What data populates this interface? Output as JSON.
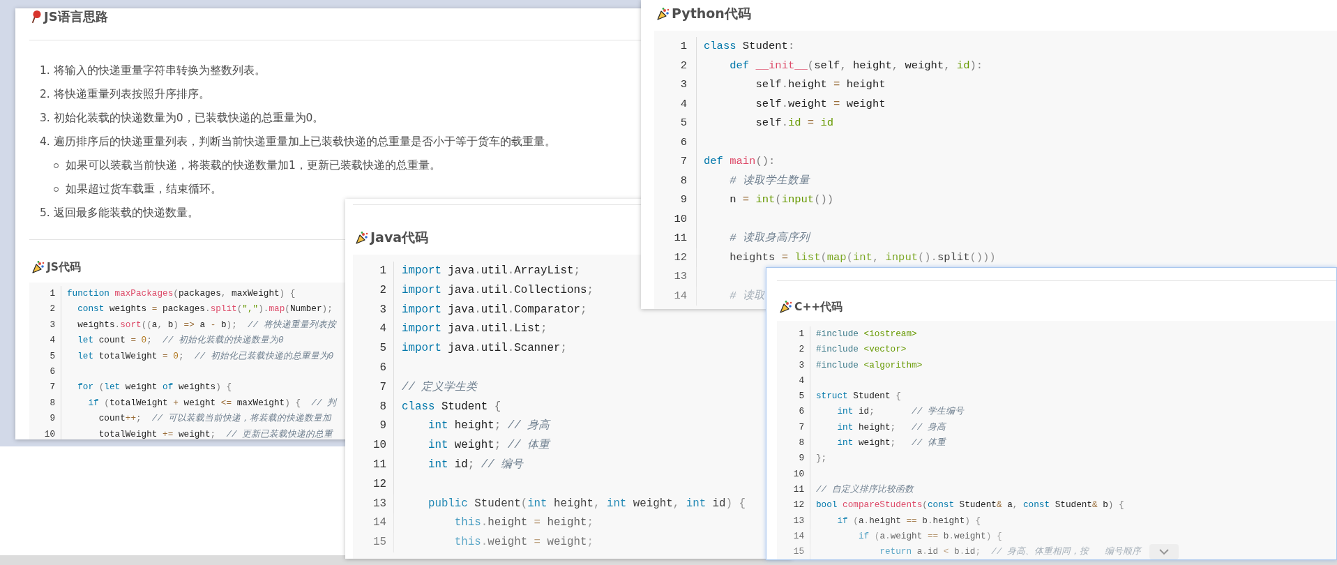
{
  "windows": [
    {
      "blocks": [
        {
          "kind": "idea_heading",
          "text": "JS语言思路"
        },
        {
          "kind": "rule"
        },
        {
          "kind": "list",
          "items": [
            {
              "num": "1.",
              "text": "将输入的快递重量字符串转换为整数列表。"
            },
            {
              "num": "2.",
              "text": "将快递重量列表按照升序排序。"
            },
            {
              "num": "3.",
              "text": "初始化装载的快递数量为0，已装载快递的总重量为0。"
            },
            {
              "num": "4.",
              "text": "遍历排序后的快递重量列表，判断当前快递重量加上已装载快递的总重量是否小于等于货车的载重量。",
              "children": [
                {
                  "text": "如果可以装载当前快递，将装载的快递数量加1，更新已装载快递的总重量。"
                },
                {
                  "text": "如果超过货车载重，结束循环。"
                }
              ]
            },
            {
              "num": "5.",
              "text": "返回最多能装载的快递数量。"
            }
          ]
        },
        {
          "kind": "rule"
        },
        {
          "kind": "code_heading",
          "text": "JS代码"
        },
        {
          "kind": "code",
          "collapsed": false,
          "lines": [
            {
              "n": "1",
              "t": [
                {
                  "kind": "kw",
                  "text": "function "
                },
                {
                  "kind": "fn",
                  "text": "maxPackages"
                },
                {
                  "kind": "pu",
                  "text": "("
                },
                {
                  "kind": "pl",
                  "text": "packages"
                },
                {
                  "kind": "pu",
                  "text": ","
                },
                {
                  "kind": "pl",
                  "text": " maxWeight"
                },
                {
                  "kind": "pu",
                  "text": ") {"
                }
              ]
            },
            {
              "n": "2",
              "t": [
                {
                  "kind": "kw",
                  "text": "  const "
                },
                {
                  "kind": "pl",
                  "text": "weights "
                },
                {
                  "kind": "op",
                  "text": "= "
                },
                {
                  "kind": "pl",
                  "text": "packages"
                },
                {
                  "kind": "pu",
                  "text": "."
                },
                {
                  "kind": "fn",
                  "text": "split"
                },
                {
                  "kind": "pu",
                  "text": "("
                },
                {
                  "kind": "st",
                  "text": "\",\""
                },
                {
                  "kind": "pu",
                  "text": ")."
                },
                {
                  "kind": "fn",
                  "text": "map"
                },
                {
                  "kind": "pu",
                  "text": "("
                },
                {
                  "kind": "pl",
                  "text": "Number"
                },
                {
                  "kind": "pu",
                  "text": ");"
                }
              ]
            },
            {
              "n": "3",
              "t": [
                {
                  "kind": "pl",
                  "text": "  weights"
                },
                {
                  "kind": "pu",
                  "text": "."
                },
                {
                  "kind": "fn",
                  "text": "sort"
                },
                {
                  "kind": "pu",
                  "text": "(("
                },
                {
                  "kind": "pl",
                  "text": "a"
                },
                {
                  "kind": "pu",
                  "text": ", "
                },
                {
                  "kind": "pl",
                  "text": "b"
                },
                {
                  "kind": "pu",
                  "text": ") "
                },
                {
                  "kind": "op",
                  "text": "=> "
                },
                {
                  "kind": "pl",
                  "text": "a "
                },
                {
                  "kind": "op",
                  "text": "- "
                },
                {
                  "kind": "pl",
                  "text": "b"
                },
                {
                  "kind": "pu",
                  "text": ");  "
                },
                {
                  "kind": "cm",
                  "text": "// 将快递重量列表按"
                }
              ]
            },
            {
              "n": "4",
              "t": [
                {
                  "kind": "kw",
                  "text": "  let "
                },
                {
                  "kind": "pl",
                  "text": "count "
                },
                {
                  "kind": "op",
                  "text": "= "
                },
                {
                  "kind": "nu",
                  "text": "0"
                },
                {
                  "kind": "pu",
                  "text": ";  "
                },
                {
                  "kind": "cm",
                  "text": "// 初始化装载的快递数量为0"
                }
              ]
            },
            {
              "n": "5",
              "t": [
                {
                  "kind": "kw",
                  "text": "  let "
                },
                {
                  "kind": "pl",
                  "text": "totalWeight "
                },
                {
                  "kind": "op",
                  "text": "= "
                },
                {
                  "kind": "nu",
                  "text": "0"
                },
                {
                  "kind": "pu",
                  "text": ";  "
                },
                {
                  "kind": "cm",
                  "text": "// 初始化已装载快递的总重量为0"
                }
              ]
            },
            {
              "n": "6"
            },
            {
              "n": "7",
              "t": [
                {
                  "kind": "kw",
                  "text": "  for "
                },
                {
                  "kind": "pu",
                  "text": "("
                },
                {
                  "kind": "kw",
                  "text": "let "
                },
                {
                  "kind": "pl",
                  "text": "weight "
                },
                {
                  "kind": "kw",
                  "text": "of "
                },
                {
                  "kind": "pl",
                  "text": "weights"
                },
                {
                  "kind": "pu",
                  "text": ") {"
                }
              ]
            },
            {
              "n": "8",
              "t": [
                {
                  "kind": "kw",
                  "text": "    if "
                },
                {
                  "kind": "pu",
                  "text": "("
                },
                {
                  "kind": "pl",
                  "text": "totalWeight "
                },
                {
                  "kind": "op",
                  "text": "+ "
                },
                {
                  "kind": "pl",
                  "text": "weight "
                },
                {
                  "kind": "op",
                  "text": "<= "
                },
                {
                  "kind": "pl",
                  "text": "maxWeight"
                },
                {
                  "kind": "pu",
                  "text": ") {  "
                },
                {
                  "kind": "cm",
                  "text": "// 判"
                }
              ]
            },
            {
              "n": "9",
              "t": [
                {
                  "kind": "pl",
                  "text": "      count"
                },
                {
                  "kind": "op",
                  "text": "++"
                },
                {
                  "kind": "pu",
                  "text": ";  "
                },
                {
                  "kind": "cm",
                  "text": "// 可以装载当前快递，将装载的快递数量加"
                }
              ]
            },
            {
              "n": "10",
              "t": [
                {
                  "kind": "pl",
                  "text": "      totalWeight "
                },
                {
                  "kind": "op",
                  "text": "+= "
                },
                {
                  "kind": "pl",
                  "text": "weight"
                },
                {
                  "kind": "pu",
                  "text": ";  "
                },
                {
                  "kind": "cm",
                  "text": "// 更新已装载快递的总重"
                }
              ]
            }
          ]
        }
      ]
    },
    {
      "blocks": [
        {
          "kind": "rule"
        },
        {
          "kind": "code_heading",
          "text": "Java代码"
        },
        {
          "kind": "code",
          "collapsed": true,
          "lines": [
            {
              "n": "1",
              "t": [
                {
                  "kind": "kw",
                  "text": "import "
                },
                {
                  "kind": "pl",
                  "text": "java"
                },
                {
                  "kind": "pu",
                  "text": "."
                },
                {
                  "kind": "pl",
                  "text": "util"
                },
                {
                  "kind": "pu",
                  "text": "."
                },
                {
                  "kind": "pl",
                  "text": "ArrayList"
                },
                {
                  "kind": "pu",
                  "text": ";"
                }
              ]
            },
            {
              "n": "2",
              "t": [
                {
                  "kind": "kw",
                  "text": "import "
                },
                {
                  "kind": "pl",
                  "text": "java"
                },
                {
                  "kind": "pu",
                  "text": "."
                },
                {
                  "kind": "pl",
                  "text": "util"
                },
                {
                  "kind": "pu",
                  "text": "."
                },
                {
                  "kind": "pl",
                  "text": "Collections"
                },
                {
                  "kind": "pu",
                  "text": ";"
                }
              ]
            },
            {
              "n": "3",
              "t": [
                {
                  "kind": "kw",
                  "text": "import "
                },
                {
                  "kind": "pl",
                  "text": "java"
                },
                {
                  "kind": "pu",
                  "text": "."
                },
                {
                  "kind": "pl",
                  "text": "util"
                },
                {
                  "kind": "pu",
                  "text": "."
                },
                {
                  "kind": "pl",
                  "text": "Comparator"
                },
                {
                  "kind": "pu",
                  "text": ";"
                }
              ]
            },
            {
              "n": "4",
              "t": [
                {
                  "kind": "kw",
                  "text": "import "
                },
                {
                  "kind": "pl",
                  "text": "java"
                },
                {
                  "kind": "pu",
                  "text": "."
                },
                {
                  "kind": "pl",
                  "text": "util"
                },
                {
                  "kind": "pu",
                  "text": "."
                },
                {
                  "kind": "pl",
                  "text": "List"
                },
                {
                  "kind": "pu",
                  "text": ";"
                }
              ]
            },
            {
              "n": "5",
              "t": [
                {
                  "kind": "kw",
                  "text": "import "
                },
                {
                  "kind": "pl",
                  "text": "java"
                },
                {
                  "kind": "pu",
                  "text": "."
                },
                {
                  "kind": "pl",
                  "text": "util"
                },
                {
                  "kind": "pu",
                  "text": "."
                },
                {
                  "kind": "pl",
                  "text": "Scanner"
                },
                {
                  "kind": "pu",
                  "text": ";"
                }
              ]
            },
            {
              "n": "6"
            },
            {
              "n": "7",
              "t": [
                {
                  "kind": "cm",
                  "text": "// 定义学生类"
                }
              ]
            },
            {
              "n": "8",
              "t": [
                {
                  "kind": "kw",
                  "text": "class "
                },
                {
                  "kind": "pl",
                  "text": "Student "
                },
                {
                  "kind": "pu",
                  "text": "{"
                }
              ]
            },
            {
              "n": "9",
              "t": [
                {
                  "kind": "kw",
                  "text": "    int "
                },
                {
                  "kind": "pl",
                  "text": "height"
                },
                {
                  "kind": "pu",
                  "text": "; "
                },
                {
                  "kind": "cm",
                  "text": "// 身高"
                }
              ]
            },
            {
              "n": "10",
              "t": [
                {
                  "kind": "kw",
                  "text": "    int "
                },
                {
                  "kind": "pl",
                  "text": "weight"
                },
                {
                  "kind": "pu",
                  "text": "; "
                },
                {
                  "kind": "cm",
                  "text": "// 体重"
                }
              ]
            },
            {
              "n": "11",
              "t": [
                {
                  "kind": "kw",
                  "text": "    int "
                },
                {
                  "kind": "pl",
                  "text": "id"
                },
                {
                  "kind": "pu",
                  "text": "; "
                },
                {
                  "kind": "cm",
                  "text": "// 编号"
                }
              ]
            },
            {
              "n": "12"
            },
            {
              "n": "13",
              "t": [
                {
                  "kind": "kw",
                  "text": "    public "
                },
                {
                  "kind": "pl",
                  "text": "Student"
                },
                {
                  "kind": "pu",
                  "text": "("
                },
                {
                  "kind": "kw",
                  "text": "int "
                },
                {
                  "kind": "pl",
                  "text": "height"
                },
                {
                  "kind": "pu",
                  "text": ", "
                },
                {
                  "kind": "kw",
                  "text": "int "
                },
                {
                  "kind": "pl",
                  "text": "weight"
                },
                {
                  "kind": "pu",
                  "text": ", "
                },
                {
                  "kind": "kw",
                  "text": "int "
                },
                {
                  "kind": "pl",
                  "text": "id"
                },
                {
                  "kind": "pu",
                  "text": ") {"
                }
              ]
            },
            {
              "n": "14",
              "t": [
                {
                  "kind": "kw",
                  "text": "        this"
                },
                {
                  "kind": "pu",
                  "text": "."
                },
                {
                  "kind": "pl",
                  "text": "height "
                },
                {
                  "kind": "op",
                  "text": "= "
                },
                {
                  "kind": "pl",
                  "text": "height"
                },
                {
                  "kind": "pu",
                  "text": ";"
                }
              ]
            },
            {
              "n": "15",
              "t": [
                {
                  "kind": "kw",
                  "text": "        this"
                },
                {
                  "kind": "pu",
                  "text": "."
                },
                {
                  "kind": "pl",
                  "text": "weight "
                },
                {
                  "kind": "op",
                  "text": "= "
                },
                {
                  "kind": "pl",
                  "text": "weight"
                },
                {
                  "kind": "pu",
                  "text": ";"
                }
              ]
            }
          ]
        }
      ]
    },
    {
      "blocks": [
        {
          "kind": "code_heading",
          "text": "Python代码"
        },
        {
          "kind": "code",
          "collapsed": true,
          "lines": [
            {
              "n": "1",
              "t": [
                {
                  "kind": "kw",
                  "text": "class "
                },
                {
                  "kind": "pl",
                  "text": "Student"
                },
                {
                  "kind": "pu",
                  "text": ":"
                }
              ]
            },
            {
              "n": "2",
              "t": [
                {
                  "kind": "kw",
                  "text": "    def "
                },
                {
                  "kind": "fn",
                  "text": "__init__"
                },
                {
                  "kind": "pu",
                  "text": "("
                },
                {
                  "kind": "pl",
                  "text": "self"
                },
                {
                  "kind": "pu",
                  "text": ", "
                },
                {
                  "kind": "pl",
                  "text": "height"
                },
                {
                  "kind": "pu",
                  "text": ", "
                },
                {
                  "kind": "pl",
                  "text": "weight"
                },
                {
                  "kind": "pu",
                  "text": ", "
                },
                {
                  "kind": "bi",
                  "text": "id"
                },
                {
                  "kind": "pu",
                  "text": "):"
                }
              ]
            },
            {
              "n": "3",
              "t": [
                {
                  "kind": "pl",
                  "text": "        self"
                },
                {
                  "kind": "pu",
                  "text": "."
                },
                {
                  "kind": "pl",
                  "text": "height "
                },
                {
                  "kind": "op",
                  "text": "= "
                },
                {
                  "kind": "pl",
                  "text": "height"
                }
              ]
            },
            {
              "n": "4",
              "t": [
                {
                  "kind": "pl",
                  "text": "        self"
                },
                {
                  "kind": "pu",
                  "text": "."
                },
                {
                  "kind": "pl",
                  "text": "weight "
                },
                {
                  "kind": "op",
                  "text": "= "
                },
                {
                  "kind": "pl",
                  "text": "weight"
                }
              ]
            },
            {
              "n": "5",
              "t": [
                {
                  "kind": "pl",
                  "text": "        self"
                },
                {
                  "kind": "pu",
                  "text": "."
                },
                {
                  "kind": "bi",
                  "text": "id "
                },
                {
                  "kind": "op",
                  "text": "= "
                },
                {
                  "kind": "bi",
                  "text": "id"
                }
              ]
            },
            {
              "n": "6"
            },
            {
              "n": "7",
              "t": [
                {
                  "kind": "kw",
                  "text": "def "
                },
                {
                  "kind": "fn",
                  "text": "main"
                },
                {
                  "kind": "pu",
                  "text": "():"
                }
              ]
            },
            {
              "n": "8",
              "t": [
                {
                  "kind": "cm",
                  "text": "    # 读取学生数量"
                }
              ]
            },
            {
              "n": "9",
              "t": [
                {
                  "kind": "pl",
                  "text": "    n "
                },
                {
                  "kind": "op",
                  "text": "= "
                },
                {
                  "kind": "bi",
                  "text": "int"
                },
                {
                  "kind": "pu",
                  "text": "("
                },
                {
                  "kind": "bi",
                  "text": "input"
                },
                {
                  "kind": "pu",
                  "text": "())"
                }
              ]
            },
            {
              "n": "10"
            },
            {
              "n": "11",
              "t": [
                {
                  "kind": "cm",
                  "text": "    # 读取身高序列"
                }
              ]
            },
            {
              "n": "12",
              "t": [
                {
                  "kind": "pl",
                  "text": "    heights "
                },
                {
                  "kind": "op",
                  "text": "= "
                },
                {
                  "kind": "bi",
                  "text": "list"
                },
                {
                  "kind": "pu",
                  "text": "("
                },
                {
                  "kind": "bi",
                  "text": "map"
                },
                {
                  "kind": "pu",
                  "text": "("
                },
                {
                  "kind": "bi",
                  "text": "int"
                },
                {
                  "kind": "pu",
                  "text": ", "
                },
                {
                  "kind": "bi",
                  "text": "input"
                },
                {
                  "kind": "pu",
                  "text": "()."
                },
                {
                  "kind": "pl",
                  "text": "split"
                },
                {
                  "kind": "pu",
                  "text": "()))"
                }
              ]
            },
            {
              "n": "13"
            },
            {
              "n": "14",
              "t": [
                {
                  "kind": "cm",
                  "text": "    # 读取"
                }
              ]
            }
          ]
        }
      ]
    },
    {
      "blocks": [
        {
          "kind": "rule"
        },
        {
          "kind": "code_heading",
          "text": "C++代码"
        },
        {
          "kind": "code",
          "collapsed": true,
          "expand_button": true,
          "lines": [
            {
              "n": "1",
              "t": [
                {
                  "kind": "di",
                  "text": "#include "
                },
                {
                  "kind": "st",
                  "text": "<iostream>"
                }
              ]
            },
            {
              "n": "2",
              "t": [
                {
                  "kind": "di",
                  "text": "#include "
                },
                {
                  "kind": "st",
                  "text": "<vector>"
                }
              ]
            },
            {
              "n": "3",
              "t": [
                {
                  "kind": "di",
                  "text": "#include "
                },
                {
                  "kind": "st",
                  "text": "<algorithm>"
                }
              ]
            },
            {
              "n": "4"
            },
            {
              "n": "5",
              "t": [
                {
                  "kind": "kw",
                  "text": "struct "
                },
                {
                  "kind": "pl",
                  "text": "Student "
                },
                {
                  "kind": "pu",
                  "text": "{"
                }
              ]
            },
            {
              "n": "6",
              "t": [
                {
                  "kind": "kw",
                  "text": "    int "
                },
                {
                  "kind": "pl",
                  "text": "id"
                },
                {
                  "kind": "pu",
                  "text": ";       "
                },
                {
                  "kind": "cm",
                  "text": "// 学生编号"
                }
              ]
            },
            {
              "n": "7",
              "t": [
                {
                  "kind": "kw",
                  "text": "    int "
                },
                {
                  "kind": "pl",
                  "text": "height"
                },
                {
                  "kind": "pu",
                  "text": ";   "
                },
                {
                  "kind": "cm",
                  "text": "// 身高"
                }
              ]
            },
            {
              "n": "8",
              "t": [
                {
                  "kind": "kw",
                  "text": "    int "
                },
                {
                  "kind": "pl",
                  "text": "weight"
                },
                {
                  "kind": "pu",
                  "text": ";   "
                },
                {
                  "kind": "cm",
                  "text": "// 体重"
                }
              ]
            },
            {
              "n": "9",
              "t": [
                {
                  "kind": "pu",
                  "text": "};"
                }
              ]
            },
            {
              "n": "10"
            },
            {
              "n": "11",
              "t": [
                {
                  "kind": "cm",
                  "text": "// 自定义排序比较函数"
                }
              ]
            },
            {
              "n": "12",
              "t": [
                {
                  "kind": "kw",
                  "text": "bool "
                },
                {
                  "kind": "fn",
                  "text": "compareStudents"
                },
                {
                  "kind": "pu",
                  "text": "("
                },
                {
                  "kind": "kw",
                  "text": "const "
                },
                {
                  "kind": "pl",
                  "text": "Student"
                },
                {
                  "kind": "op",
                  "text": "& "
                },
                {
                  "kind": "pl",
                  "text": "a"
                },
                {
                  "kind": "pu",
                  "text": ", "
                },
                {
                  "kind": "kw",
                  "text": "const "
                },
                {
                  "kind": "pl",
                  "text": "Student"
                },
                {
                  "kind": "op",
                  "text": "& "
                },
                {
                  "kind": "pl",
                  "text": "b"
                },
                {
                  "kind": "pu",
                  "text": ") {"
                }
              ]
            },
            {
              "n": "13",
              "t": [
                {
                  "kind": "kw",
                  "text": "    if "
                },
                {
                  "kind": "pu",
                  "text": "("
                },
                {
                  "kind": "pl",
                  "text": "a"
                },
                {
                  "kind": "pu",
                  "text": "."
                },
                {
                  "kind": "pl",
                  "text": "height "
                },
                {
                  "kind": "op",
                  "text": "== "
                },
                {
                  "kind": "pl",
                  "text": "b"
                },
                {
                  "kind": "pu",
                  "text": "."
                },
                {
                  "kind": "pl",
                  "text": "height"
                },
                {
                  "kind": "pu",
                  "text": ") {"
                }
              ]
            },
            {
              "n": "14",
              "t": [
                {
                  "kind": "kw",
                  "text": "        if "
                },
                {
                  "kind": "pu",
                  "text": "("
                },
                {
                  "kind": "pl",
                  "text": "a"
                },
                {
                  "kind": "pu",
                  "text": "."
                },
                {
                  "kind": "pl",
                  "text": "weight "
                },
                {
                  "kind": "op",
                  "text": "== "
                },
                {
                  "kind": "pl",
                  "text": "b"
                },
                {
                  "kind": "pu",
                  "text": "."
                },
                {
                  "kind": "pl",
                  "text": "weight"
                },
                {
                  "kind": "pu",
                  "text": ") {"
                }
              ]
            },
            {
              "n": "15",
              "t": [
                {
                  "kind": "kw",
                  "text": "            return "
                },
                {
                  "kind": "pl",
                  "text": "a"
                },
                {
                  "kind": "pu",
                  "text": "."
                },
                {
                  "kind": "pl",
                  "text": "id "
                },
                {
                  "kind": "op",
                  "text": "< "
                },
                {
                  "kind": "pl",
                  "text": "b"
                },
                {
                  "kind": "pu",
                  "text": "."
                },
                {
                  "kind": "pl",
                  "text": "id"
                },
                {
                  "kind": "pu",
                  "text": ";  "
                },
                {
                  "kind": "cm",
                  "text": "// 身高、体重相同，按"
                },
                {
                  "kind": "cm",
                  "text": "   编号顺序"
                }
              ]
            }
          ]
        }
      ]
    }
  ]
}
